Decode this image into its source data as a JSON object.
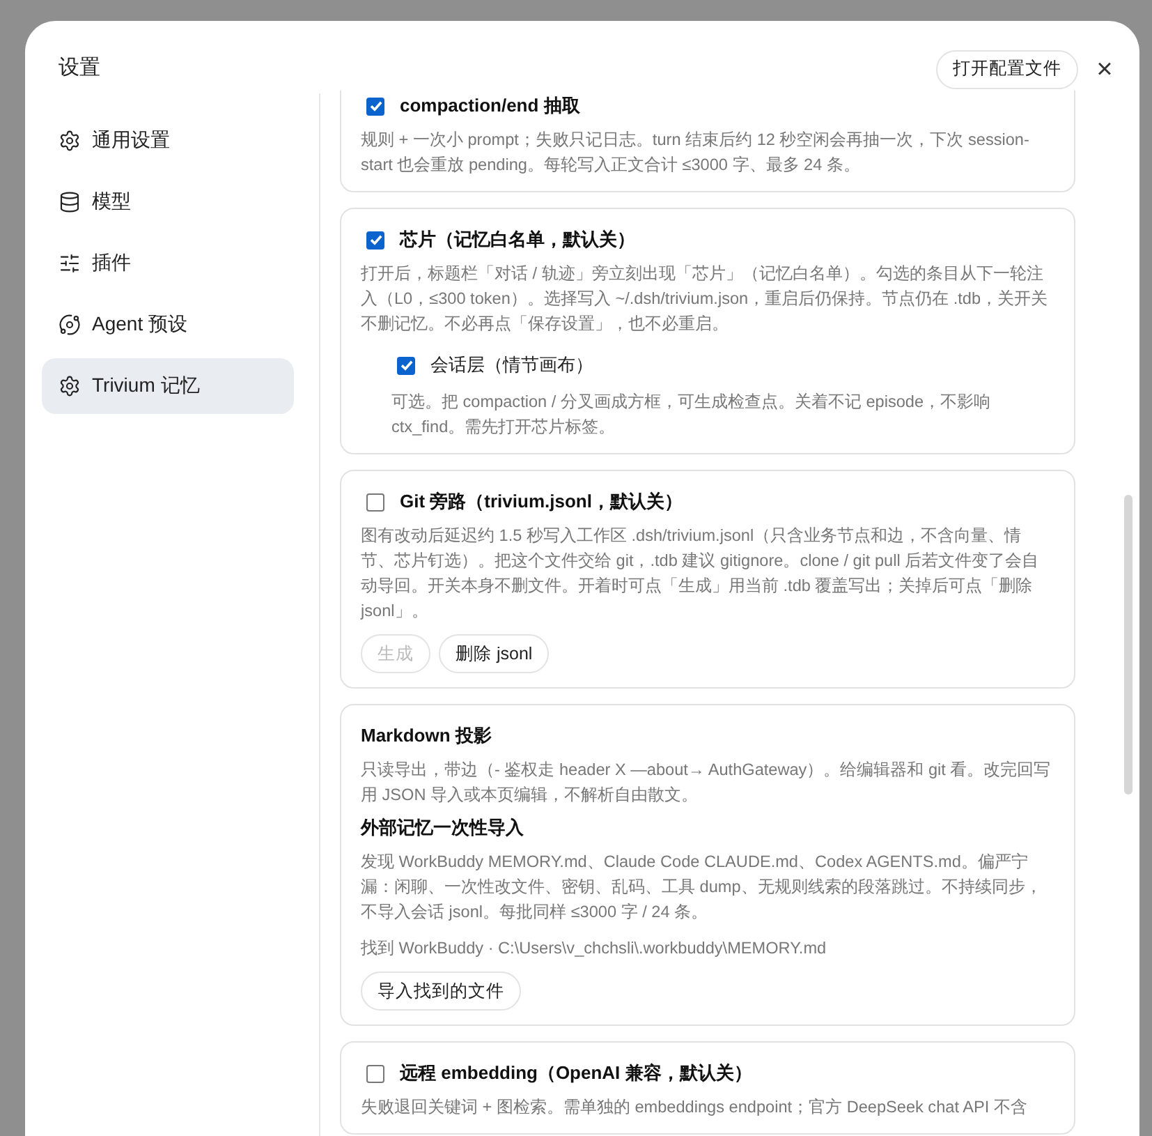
{
  "dialog": {
    "title": "设置",
    "open_config_button": "打开配置文件",
    "close": "×"
  },
  "sidebar": {
    "items": [
      {
        "label": "通用设置",
        "selected": false
      },
      {
        "label": "模型",
        "selected": false
      },
      {
        "label": "插件",
        "selected": false
      },
      {
        "label": "Agent 预设",
        "selected": false
      },
      {
        "label": "Trivium 记忆",
        "selected": true
      }
    ]
  },
  "cards": [
    {
      "kind": "toggle",
      "title": "compaction/end 抽取",
      "checked": true,
      "description": "规则 + 一次小 prompt；失败只记日志。turn 结束后约 12 秒空闲会再抽一次，下次 session-start 也会重放 pending。每轮写入正文合计 ≤3000 字、最多 24 条。"
    },
    {
      "kind": "toggle",
      "title": "芯片（记忆白名单，默认关）",
      "checked": true,
      "description": "打开后，标题栏「对话 / 轨迹」旁立刻出现「芯片」（记忆白名单）。勾选的条目从下一轮注入（L0，≤300 token）。选择写入 ~/.dsh/trivium.json，重启后仍保持。节点仍在 .tdb，关开关不删记忆。不必再点「保存设置」，也不必重启。",
      "options": [
        {
          "label": "会话层（情节画布）",
          "checked": true,
          "description": "可选。把 compaction / 分叉画成方框，可生成检查点。关着不记 episode，不影响 ctx_find。需先打开芯片标签。"
        }
      ]
    },
    {
      "kind": "toggle",
      "title": "Git 旁路（trivium.jsonl，默认关）",
      "checked": false,
      "description": "图有改动后延迟约 1.5 秒写入工作区 .dsh/trivium.jsonl（只含业务节点和边，不含向量、情节、芯片钉选）。把这个文件交给 git，.tdb 建议 gitignore。clone / git pull 后若文件变了会自动导回。开关本身不删文件。开着时可点「生成」用当前 .tdb 覆盖写出；关掉后可点「删除 jsonl」。",
      "buttons": [
        {
          "label": "生成",
          "disabled": true
        },
        {
          "label": "删除 jsonl",
          "disabled": false
        }
      ]
    },
    {
      "kind": "info",
      "sections": [
        {
          "heading": "Markdown 投影",
          "text": "只读导出，带边（- 鉴权走 header X —about→ AuthGateway）。给编辑器和 git 看。改完回写用 JSON 导入或本页编辑，不解析自由散文。"
        },
        {
          "heading": "外部记忆一次性导入",
          "text": "发现 WorkBuddy MEMORY.md、Claude Code CLAUDE.md、Codex AGENTS.md。偏严宁漏：闲聊、一次性改文件、密钥、乱码、工具 dump、无规则线索的段落跳过。不持续同步，不导入会话 jsonl。每批同样 ≤3000 字 / 24 条。"
        }
      ],
      "found": "找到 WorkBuddy · C:\\Users\\v_chchsli\\.workbuddy\\MEMORY.md",
      "buttons": [
        {
          "label": "导入找到的文件",
          "disabled": false
        }
      ]
    },
    {
      "kind": "toggle",
      "title": "远程 embedding（OpenAI 兼容，默认关）",
      "checked": false,
      "description": "失败退回关键词 + 图检索。需单独的 embeddings endpoint；官方 DeepSeek chat API 不含"
    }
  ]
}
